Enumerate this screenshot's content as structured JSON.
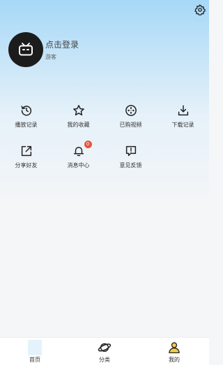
{
  "header": {
    "login_title": "点击登录",
    "guest_label": "游客",
    "settings_icon": "gear-icon",
    "avatar_icon": "bilibili-tv-icon"
  },
  "menu": {
    "row1": [
      {
        "label": "播放记录",
        "icon": "history-icon"
      },
      {
        "label": "我的收藏",
        "icon": "star-icon"
      },
      {
        "label": "已购视频",
        "icon": "film-reel-icon"
      },
      {
        "label": "下载记录",
        "icon": "download-icon"
      }
    ],
    "row2": [
      {
        "label": "分享好友",
        "icon": "share-icon"
      },
      {
        "label": "消息中心",
        "icon": "bell-icon",
        "badge": "0"
      },
      {
        "label": "意见反馈",
        "icon": "feedback-icon"
      }
    ]
  },
  "tabbar": {
    "items": [
      {
        "label": "首页",
        "icon": "home-icon"
      },
      {
        "label": "分类",
        "icon": "planet-icon"
      },
      {
        "label": "我的",
        "icon": "user-icon"
      }
    ]
  },
  "colors": {
    "accent_top": "#a6d8f7",
    "badge": "#e5533c",
    "background": "#f5f6f8"
  }
}
